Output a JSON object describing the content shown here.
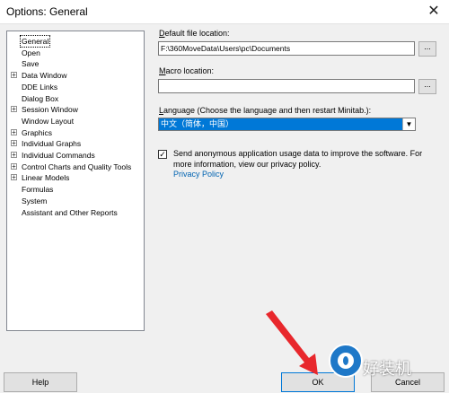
{
  "window": {
    "title": "Options: General",
    "close_glyph": "✕"
  },
  "tree": {
    "items": [
      {
        "label": "General",
        "expandable": false,
        "selected": true
      },
      {
        "label": "Open",
        "expandable": false
      },
      {
        "label": "Save",
        "expandable": false
      },
      {
        "label": "Data Window",
        "expandable": true
      },
      {
        "label": "DDE Links",
        "expandable": false
      },
      {
        "label": "Dialog Box",
        "expandable": false
      },
      {
        "label": "Session Window",
        "expandable": true
      },
      {
        "label": "Window Layout",
        "expandable": false
      },
      {
        "label": "Graphics",
        "expandable": true
      },
      {
        "label": "Individual Graphs",
        "expandable": true
      },
      {
        "label": "Individual Commands",
        "expandable": true
      },
      {
        "label": "Control Charts and Quality Tools",
        "expandable": true
      },
      {
        "label": "Linear Models",
        "expandable": true
      },
      {
        "label": "Formulas",
        "expandable": false
      },
      {
        "label": "System",
        "expandable": false
      },
      {
        "label": "Assistant and Other Reports",
        "expandable": false
      }
    ]
  },
  "default_file": {
    "label_underlined": "D",
    "label_rest": "efault file location:",
    "value": "F:\\360MoveData\\Users\\pc\\Documents",
    "browse": "..."
  },
  "macro": {
    "label_underlined": "M",
    "label_rest": "acro location:",
    "value": "",
    "browse": "..."
  },
  "language": {
    "label_underlined": "L",
    "label_rest": "anguage (Choose the language and then restart Minitab.):",
    "selected": "中文（简体，中国）"
  },
  "telemetry": {
    "checked": true,
    "text": "Send anonymous application usage data to improve the software. For more information, view our privacy policy.",
    "link": "Privacy Policy"
  },
  "buttons": {
    "help": "Help",
    "ok": "OK",
    "cancel": "Cancel"
  },
  "watermark": {
    "text": "好装机"
  },
  "colors": {
    "accent": "#0078d7",
    "link": "#0063b1",
    "arrow": "#e8272c"
  }
}
